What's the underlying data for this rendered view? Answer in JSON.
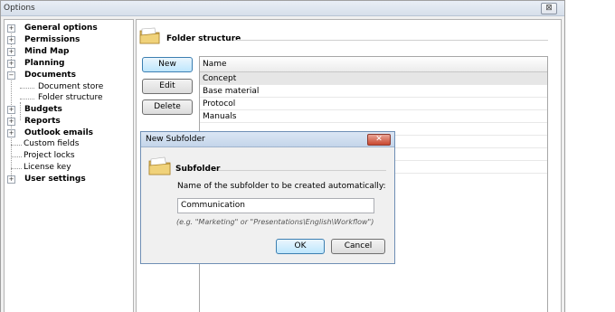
{
  "window": {
    "title": "Options",
    "close_glyph": "⊠"
  },
  "tree": {
    "items": [
      {
        "label": "General options",
        "bold": true,
        "expander": "+"
      },
      {
        "label": "Permissions",
        "bold": true,
        "expander": "+"
      },
      {
        "label": "Mind Map",
        "bold": true,
        "expander": "+"
      },
      {
        "label": "Planning",
        "bold": true,
        "expander": "+"
      },
      {
        "label": "Documents",
        "bold": true,
        "expander": "−"
      },
      {
        "label": "Document store",
        "bold": false,
        "child": true
      },
      {
        "label": "Folder structure",
        "bold": false,
        "child": true,
        "selected": true
      },
      {
        "label": "Budgets",
        "bold": true,
        "expander": "+"
      },
      {
        "label": "Reports",
        "bold": true,
        "expander": "+"
      },
      {
        "label": "Outlook emails",
        "bold": true,
        "expander": "+"
      },
      {
        "label": "Custom fields",
        "bold": false
      },
      {
        "label": "Project locks",
        "bold": false
      },
      {
        "label": "License key",
        "bold": false
      },
      {
        "label": "User settings",
        "bold": true,
        "expander": "+"
      }
    ]
  },
  "section": {
    "title": "Folder structure",
    "icon": "folder-icon"
  },
  "buttons": {
    "new": "New",
    "edit": "Edit",
    "delete": "Delete"
  },
  "list": {
    "column": "Name",
    "rows": [
      "Concept",
      "Base material",
      "Protocol",
      "Manuals"
    ]
  },
  "dialog": {
    "title": "New Subfolder",
    "close_glyph": "✕",
    "heading": "Subfolder",
    "label": "Name of the subfolder to be created automatically:",
    "input_value": "Communication",
    "hint": "(e.g. \"Marketing\" or \"Presentations\\English\\Workflow\")",
    "ok": "OK",
    "cancel": "Cancel"
  },
  "colors": {
    "folder": "#e8c86a",
    "accent": "#3c7fb1",
    "close_red": "#c8472f"
  }
}
